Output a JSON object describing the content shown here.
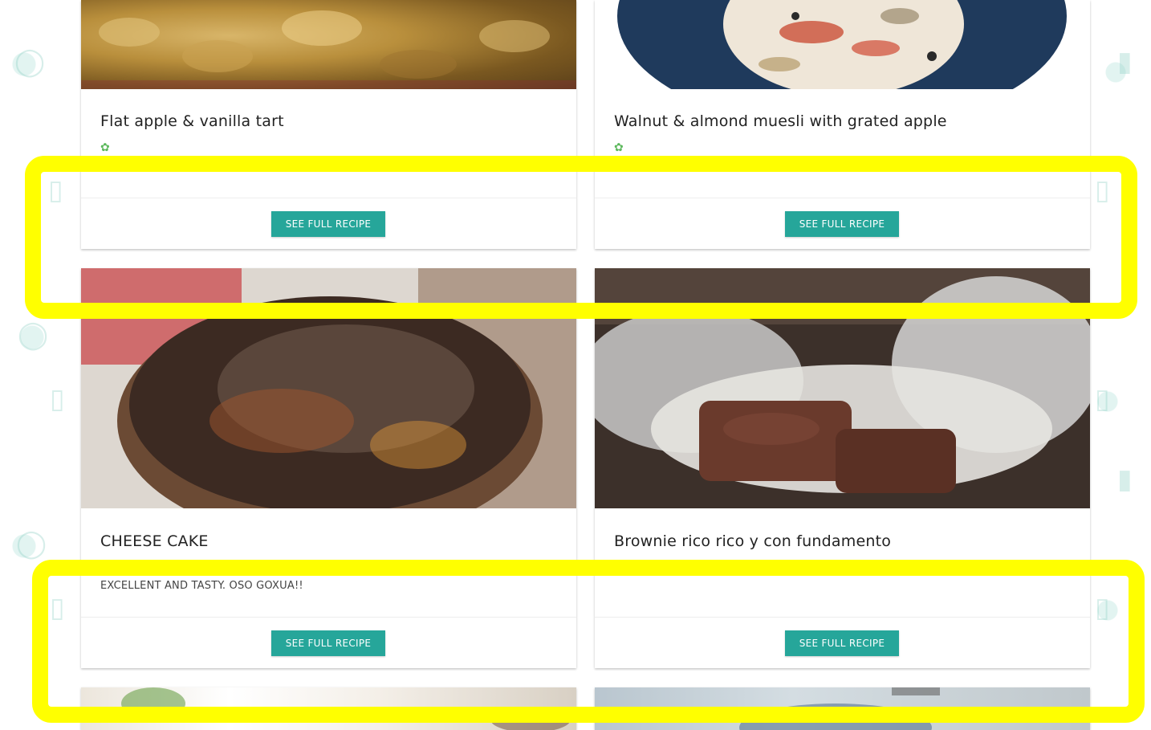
{
  "cards": [
    {
      "title": "Flat apple & vanilla tart",
      "tag_icon": "carrot-icon",
      "description": "",
      "action_label": "SEE FULL RECIPE",
      "image": "apple-tart-photo"
    },
    {
      "title": "Walnut & almond muesli with grated apple",
      "tag_icon": "carrot-icon",
      "description": "",
      "action_label": "SEE FULL RECIPE",
      "image": "muesli-photo"
    },
    {
      "title": "CHEESE CAKE",
      "description": "EXCELLENT AND TASTY. OSO GOXUA!!",
      "action_label": "SEE FULL RECIPE",
      "image": "cheesecake-photo"
    },
    {
      "title": "Brownie rico rico y con fundamento",
      "description": "",
      "action_label": "SEE FULL RECIPE",
      "image": "brownie-photo"
    }
  ],
  "colors": {
    "button": "#26a69a",
    "highlight": "#ffff00",
    "veg_icon": "#5cb85c"
  }
}
